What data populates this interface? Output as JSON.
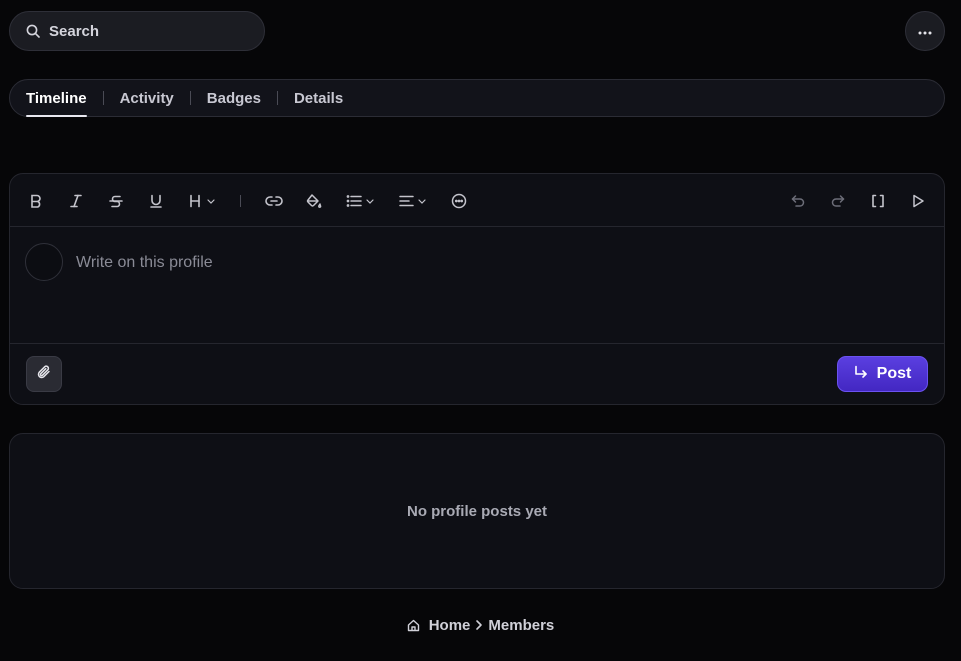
{
  "search": {
    "label": "Search",
    "icon": "search-icon"
  },
  "header": {
    "more_icon": "more-horizontal-icon"
  },
  "tabs": [
    {
      "label": "Timeline",
      "active": true
    },
    {
      "label": "Activity",
      "active": false
    },
    {
      "label": "Badges",
      "active": false
    },
    {
      "label": "Details",
      "active": false
    }
  ],
  "editor": {
    "toolbar": [
      "bold-icon",
      "italic-icon",
      "strikethrough-icon",
      "underline-icon",
      "heading-icon",
      "link-icon",
      "text-color-icon",
      "list-icon",
      "align-icon",
      "emoji-icon",
      "undo-icon",
      "redo-icon",
      "bbcode-icon",
      "preview-icon"
    ],
    "placeholder": "Write on this profile",
    "attach_icon": "paperclip-icon",
    "post_label": "Post",
    "post_icon": "reply-arrow-icon",
    "accent_color": "#4a2fd0"
  },
  "posts": {
    "empty_text": "No profile posts yet"
  },
  "breadcrumb": {
    "home_icon": "home-icon",
    "items": [
      "Home",
      "Members"
    ],
    "separator_icon": "chevron-right-icon"
  }
}
